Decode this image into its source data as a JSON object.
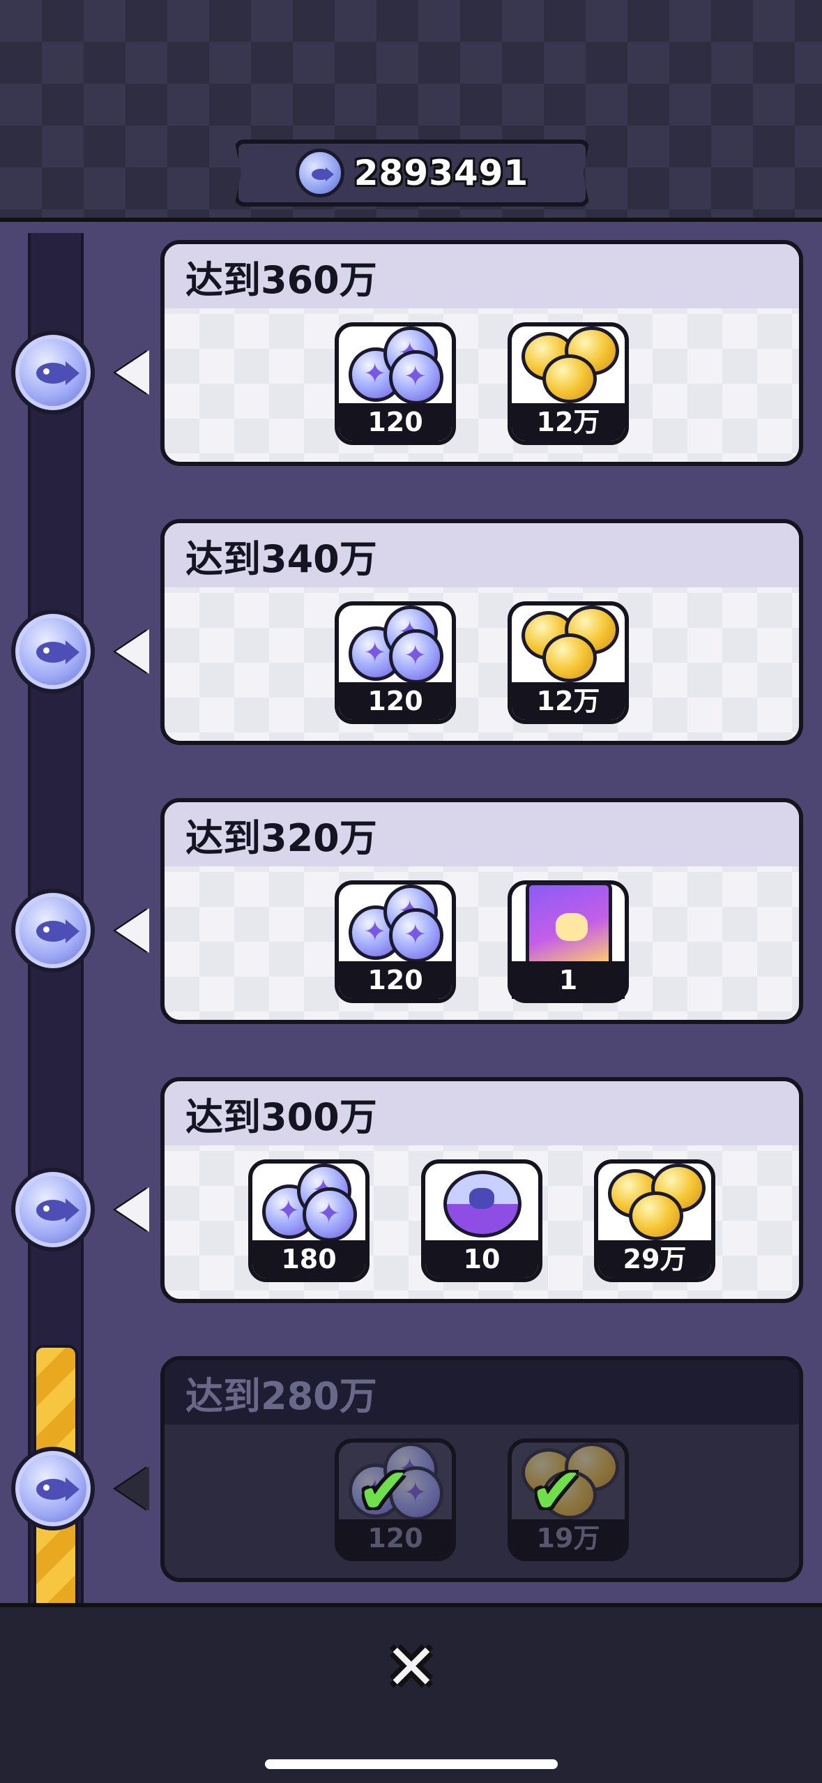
{
  "header": {
    "total_value": "2893491",
    "icon": "fish-coin-icon"
  },
  "tiers": [
    {
      "title": "达到360万",
      "state": "locked",
      "rewards": [
        {
          "icon": "gem-icon",
          "qty": "120"
        },
        {
          "icon": "candy-icon",
          "qty": "12万"
        }
      ]
    },
    {
      "title": "达到340万",
      "state": "locked",
      "rewards": [
        {
          "icon": "gem-icon",
          "qty": "120"
        },
        {
          "icon": "candy-icon",
          "qty": "12万"
        }
      ]
    },
    {
      "title": "达到320万",
      "state": "locked",
      "rewards": [
        {
          "icon": "gem-icon",
          "qty": "120"
        },
        {
          "icon": "card-pack-icon",
          "qty": "1"
        }
      ]
    },
    {
      "title": "达到300万",
      "state": "locked",
      "rewards": [
        {
          "icon": "gem-icon",
          "qty": "180"
        },
        {
          "icon": "capsule-icon",
          "qty": "10"
        },
        {
          "icon": "candy-icon",
          "qty": "29万"
        }
      ]
    },
    {
      "title": "达到280万",
      "state": "claimed",
      "rewards": [
        {
          "icon": "gem-icon",
          "qty": "120"
        },
        {
          "icon": "candy-icon",
          "qty": "19万"
        }
      ]
    }
  ],
  "footer": {
    "close_icon": "close-icon"
  },
  "colors": {
    "background": "#4e4672",
    "card": "#f3f3f7",
    "progress": "#f6c640",
    "check": "#6fe04a"
  }
}
